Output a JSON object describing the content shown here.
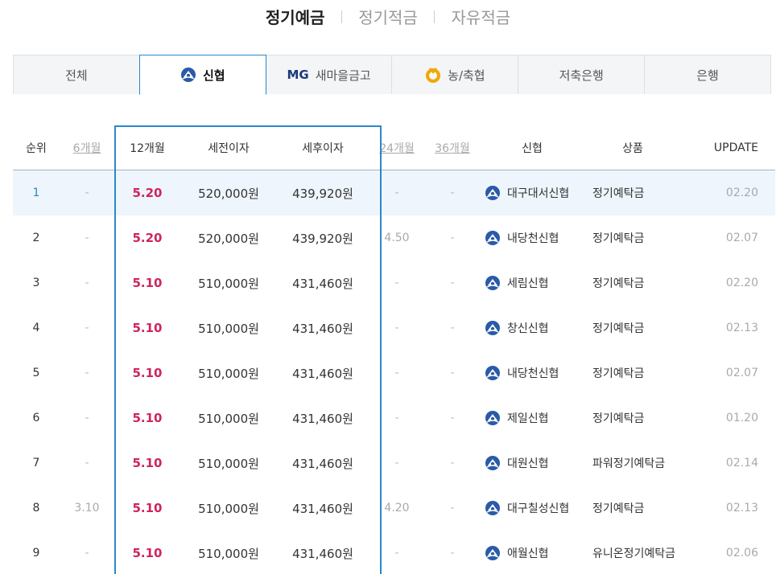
{
  "top_tabs": [
    {
      "label": "정기예금",
      "active": true
    },
    {
      "label": "정기적금",
      "active": false
    },
    {
      "label": "자유적금",
      "active": false
    }
  ],
  "inst_tabs": [
    {
      "label": "전체",
      "icon": ""
    },
    {
      "label": "신협",
      "icon": "shinhyup-logo-icon"
    },
    {
      "label": "새마을금고",
      "prefix": "MG",
      "icon": "mg-logo-icon"
    },
    {
      "label": "농/축협",
      "icon": "nonghyup-logo-icon"
    },
    {
      "label": "저축은행",
      "icon": ""
    },
    {
      "label": "은행",
      "icon": ""
    }
  ],
  "table": {
    "headers": {
      "rank": "순위",
      "m6": "6개월",
      "m12": "12개월",
      "pretax": "세전이자",
      "posttax": "세후이자",
      "m24": "24개월",
      "m36": "36개월",
      "bank": "신협",
      "product": "상품",
      "update": "UPDATE"
    },
    "rows": [
      {
        "rank": "1",
        "m6": "-",
        "m12": "5.20",
        "pretax": "520,000원",
        "posttax": "439,920원",
        "m24": "-",
        "m36": "-",
        "bank": "대구대서신협",
        "product": "정기예탁금",
        "update": "02.20"
      },
      {
        "rank": "2",
        "m6": "-",
        "m12": "5.20",
        "pretax": "520,000원",
        "posttax": "439,920원",
        "m24": "4.50",
        "m36": "-",
        "bank": "내당천신협",
        "product": "정기예탁금",
        "update": "02.07"
      },
      {
        "rank": "3",
        "m6": "-",
        "m12": "5.10",
        "pretax": "510,000원",
        "posttax": "431,460원",
        "m24": "-",
        "m36": "-",
        "bank": "세림신협",
        "product": "정기예탁금",
        "update": "02.20"
      },
      {
        "rank": "4",
        "m6": "-",
        "m12": "5.10",
        "pretax": "510,000원",
        "posttax": "431,460원",
        "m24": "-",
        "m36": "-",
        "bank": "창신신협",
        "product": "정기예탁금",
        "update": "02.13"
      },
      {
        "rank": "5",
        "m6": "-",
        "m12": "5.10",
        "pretax": "510,000원",
        "posttax": "431,460원",
        "m24": "-",
        "m36": "-",
        "bank": "내당천신협",
        "product": "정기예탁금",
        "update": "02.07"
      },
      {
        "rank": "6",
        "m6": "-",
        "m12": "5.10",
        "pretax": "510,000원",
        "posttax": "431,460원",
        "m24": "-",
        "m36": "-",
        "bank": "제일신협",
        "product": "정기예탁금",
        "update": "01.20"
      },
      {
        "rank": "7",
        "m6": "-",
        "m12": "5.10",
        "pretax": "510,000원",
        "posttax": "431,460원",
        "m24": "-",
        "m36": "-",
        "bank": "대원신협",
        "product": "파워정기예탁금",
        "update": "02.14"
      },
      {
        "rank": "8",
        "m6": "3.10",
        "m12": "5.10",
        "pretax": "510,000원",
        "posttax": "431,460원",
        "m24": "4.20",
        "m36": "-",
        "bank": "대구칠성신협",
        "product": "정기예탁금",
        "update": "02.13"
      },
      {
        "rank": "9",
        "m6": "-",
        "m12": "5.10",
        "pretax": "510,000원",
        "posttax": "431,460원",
        "m24": "-",
        "m36": "-",
        "bank": "애월신협",
        "product": "유니온정기예탁금",
        "update": "02.06"
      }
    ]
  },
  "colors": {
    "accent": "#2b88c8",
    "rate": "#d0245a"
  }
}
